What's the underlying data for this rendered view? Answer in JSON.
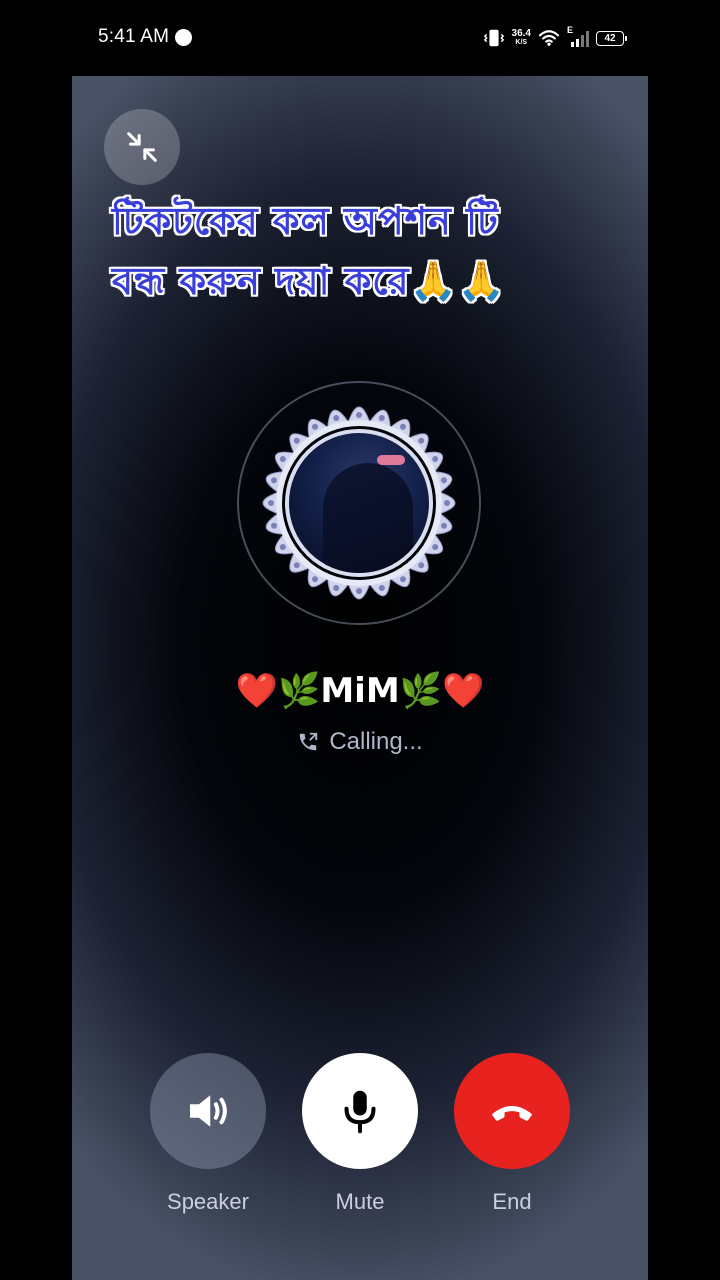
{
  "status_bar": {
    "time": "5:41 AM",
    "net_speed_value": "36.4",
    "net_speed_unit": "K/S",
    "network_type": "E",
    "battery_level": "42"
  },
  "banner": {
    "line1": "টিকটকের কল অপশন টি",
    "line2": "বন্ধ করুন দয়া করে🙏🙏"
  },
  "caller": {
    "name": "❤️🌿MiM🌿❤️",
    "status": "Calling..."
  },
  "controls": {
    "speaker_label": "Speaker",
    "mute_label": "Mute",
    "end_label": "End"
  },
  "colors": {
    "end_button": "#e8231f",
    "banner_text": "#3a3fd9"
  }
}
